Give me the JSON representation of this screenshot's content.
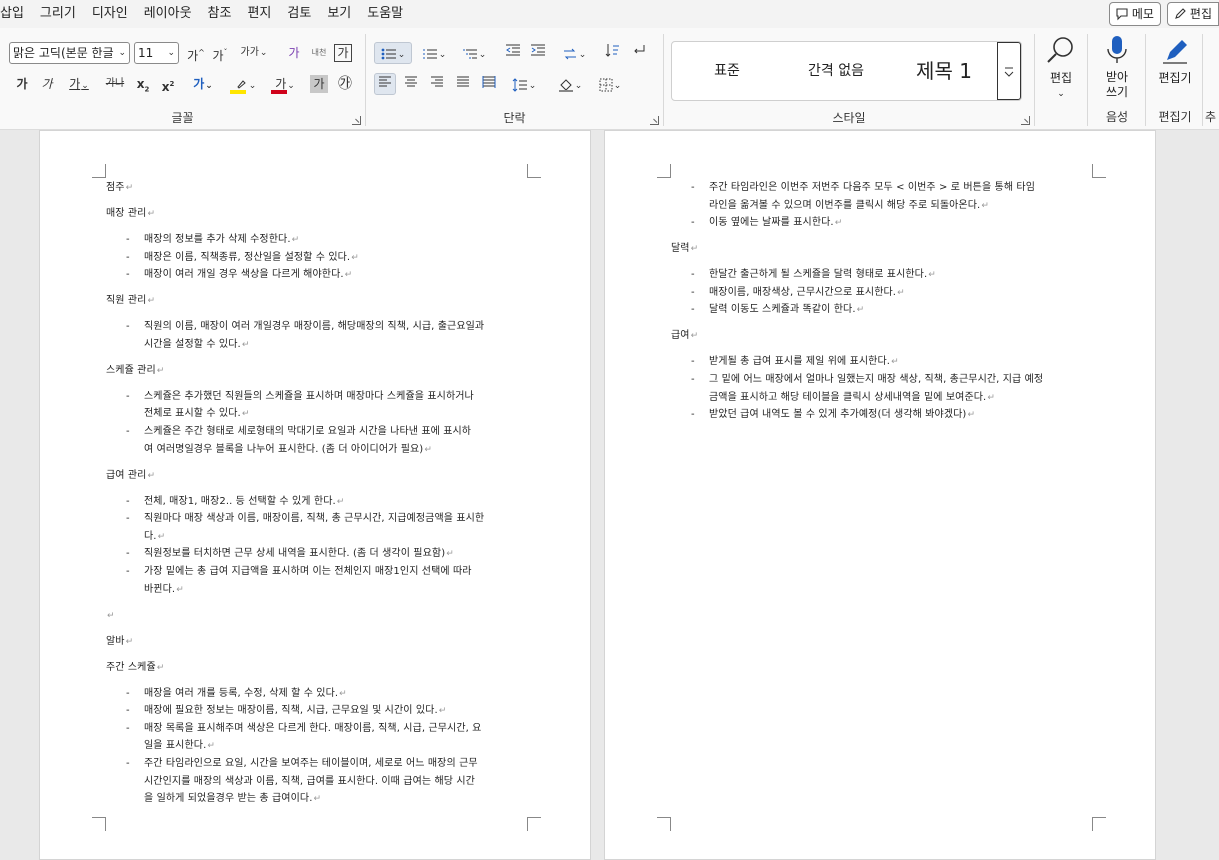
{
  "menu": [
    "삽입",
    "그리기",
    "디자인",
    "레이아웃",
    "참조",
    "편지",
    "검토",
    "보기",
    "도움말"
  ],
  "top_right": {
    "memo_label": "메모",
    "edit_label": "편집"
  },
  "ribbon": {
    "font_name": "맑은 고딕(본문 한글",
    "font_size": "11",
    "grow_font": "가",
    "shrink_font": "가",
    "case": "가가",
    "phonetic": "가",
    "char_border": "가",
    "bold": "가",
    "italic": "가",
    "underline": "가",
    "strike": "가나",
    "subscript": "x",
    "superscript": "x",
    "font_color_letter": "가",
    "char_shade": "가",
    "enclose": "㉮",
    "font_group_label": "글꼴",
    "paragraph_group_label": "단락",
    "styles_group_label": "스타일",
    "styles": [
      "표준",
      "간격 없음",
      "제목 1"
    ],
    "editing_label": "편집",
    "dictate_label": "받아\n쓰기",
    "voice_group_label": "음성",
    "editor_label": "편집기",
    "editor_group_label": "편집기",
    "trailing_label": "추"
  },
  "page1": [
    {
      "kind": "h",
      "text": "점주"
    },
    {
      "kind": "h",
      "text": "매장 관리"
    },
    {
      "kind": "b",
      "lines": [
        "매장의 정보를 추가 삭제 수정한다."
      ]
    },
    {
      "kind": "b",
      "lines": [
        "매장은 이름, 직책종류, 정산일을 설정할 수 있다."
      ]
    },
    {
      "kind": "b",
      "lines": [
        "매장이 여러 개일 경우 색상을 다르게 해야한다."
      ]
    },
    {
      "kind": "h",
      "text": "직원 관리"
    },
    {
      "kind": "b",
      "lines": [
        "직원의 이름, 매장이 여러 개일경우 매장이름, 해당매장의 직책, 시급, 출근요일과",
        "시간을 설정할 수 있다."
      ]
    },
    {
      "kind": "h",
      "text": "스케쥴 관리"
    },
    {
      "kind": "b",
      "lines": [
        "스케쥴은 추가했던 직원들의 스케쥴을 표시하며 매장마다 스케쥴을 표시하거나",
        "전체로 표시할 수 있다."
      ]
    },
    {
      "kind": "b",
      "lines": [
        "스케쥴은 주간 형태로 세로형태의 막대기로 요일과 시간을 나타낸 표에 표시하",
        "여 여러명일경우 블록을 나누어 표시한다. (좀 더 아이디어가 필요)"
      ]
    },
    {
      "kind": "h",
      "text": "급여 관리"
    },
    {
      "kind": "b",
      "lines": [
        "전체, 매장1, 매장2.. 등 선택할 수 있게 한다."
      ]
    },
    {
      "kind": "b",
      "lines": [
        "직원마다 매장 색상과 이름, 매장이름, 직책, 총 근무시간, 지급예정금액을 표시한",
        "다."
      ]
    },
    {
      "kind": "b",
      "lines": [
        "직원정보를 터치하면 근무 상세 내역을 표시한다. (좀 더 생각이 필요함)"
      ]
    },
    {
      "kind": "b",
      "lines": [
        "가장 밑에는 총 급여 지급액을 표시하며 이는 전체인지 매장1인지 선택에 따라",
        "바뀐다."
      ]
    },
    {
      "kind": "e",
      "text": ""
    },
    {
      "kind": "h",
      "text": "알바"
    },
    {
      "kind": "h",
      "text": "주간 스케쥴"
    },
    {
      "kind": "b",
      "lines": [
        "매장을 여러 개를 등록, 수정, 삭제 할 수 있다."
      ]
    },
    {
      "kind": "b",
      "lines": [
        "매장에 필요한 정보는 매장이름, 직책, 시급, 근무요일 및 시간이 있다."
      ]
    },
    {
      "kind": "b",
      "lines": [
        "매장 목록을 표시해주며 색상은 다르게 한다. 매장이름, 직책, 시급, 근무시간, 요",
        "일을 표시한다."
      ]
    },
    {
      "kind": "b",
      "lines": [
        "주간 타임라인으로 요일, 시간을 보여주는 테이블이며, 세로로 어느 매장의 근무",
        "시간인지를 매장의 색상과 이름, 직책, 급여를 표시한다. 이때 급여는 해당 시간",
        "을 일하게 되었을경우 받는 총 급여이다."
      ]
    }
  ],
  "page2": [
    {
      "kind": "b",
      "lines": [
        "주간 타임라인은 이번주 저번주 다음주 모두 < 이번주 > 로 버튼을 통해 타임",
        "라인을 옮겨볼 수 있으며 이번주를 클릭시 해당 주로 되돌아온다."
      ]
    },
    {
      "kind": "b",
      "lines": [
        "이동 옆에는 날짜를 표시한다."
      ]
    },
    {
      "kind": "h",
      "text": "달력"
    },
    {
      "kind": "b",
      "lines": [
        "한달간 출근하게 될 스케쥴을 달력 형태로 표시한다."
      ]
    },
    {
      "kind": "b",
      "lines": [
        "매장이름, 매장색상, 근무시간으로 표시한다."
      ]
    },
    {
      "kind": "b",
      "lines": [
        "달력 이동도 스케쥴과 똑같이 한다."
      ]
    },
    {
      "kind": "h",
      "text": "급여"
    },
    {
      "kind": "b",
      "lines": [
        "받게될 총 급여 표시를 제일 위에 표시한다."
      ]
    },
    {
      "kind": "b",
      "lines": [
        "그 밑에 어느 매장에서 얼마나 일했는지 매장 색상, 직책, 총근무시간, 지급 예정",
        "금액을 표시하고 해당 테이블을 클릭시 상세내역을 밑에 보여준다."
      ]
    },
    {
      "kind": "b",
      "lines": [
        "받았던 급여 내역도 볼 수 있게 추가예정(더 생각해 봐야겠다)"
      ]
    }
  ]
}
